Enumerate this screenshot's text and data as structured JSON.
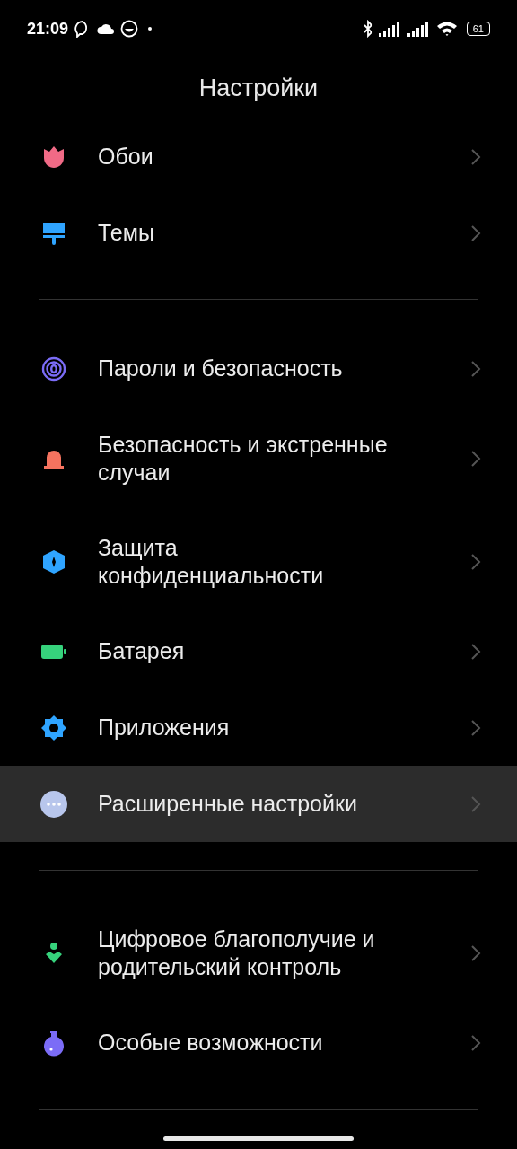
{
  "status_bar": {
    "time": "21:09",
    "battery": "61"
  },
  "title": "Настройки",
  "groups": [
    {
      "items": [
        {
          "lines": [
            "Обои"
          ],
          "kind": "tulip",
          "selected": false
        },
        {
          "lines": [
            "Темы"
          ],
          "kind": "brush",
          "selected": false
        }
      ]
    },
    {
      "items": [
        {
          "lines": [
            "Пароли и безопасность"
          ],
          "kind": "fingerprint",
          "selected": false
        },
        {
          "lines": [
            "Безопасность и экстренные",
            "случаи"
          ],
          "kind": "beacon",
          "selected": false
        },
        {
          "lines": [
            "Защита",
            "конфиденциальности"
          ],
          "kind": "shield",
          "selected": false
        },
        {
          "lines": [
            "Батарея"
          ],
          "kind": "battery",
          "selected": false
        },
        {
          "lines": [
            "Приложения"
          ],
          "kind": "gear",
          "selected": false
        },
        {
          "lines": [
            "Расширенные настройки"
          ],
          "kind": "dots",
          "selected": true
        }
      ]
    },
    {
      "items": [
        {
          "lines": [
            "Цифровое благополучие и",
            "родительский контроль"
          ],
          "kind": "wellbeing",
          "selected": false
        },
        {
          "lines": [
            "Особые возможности"
          ],
          "kind": "flask",
          "selected": false
        }
      ]
    }
  ]
}
